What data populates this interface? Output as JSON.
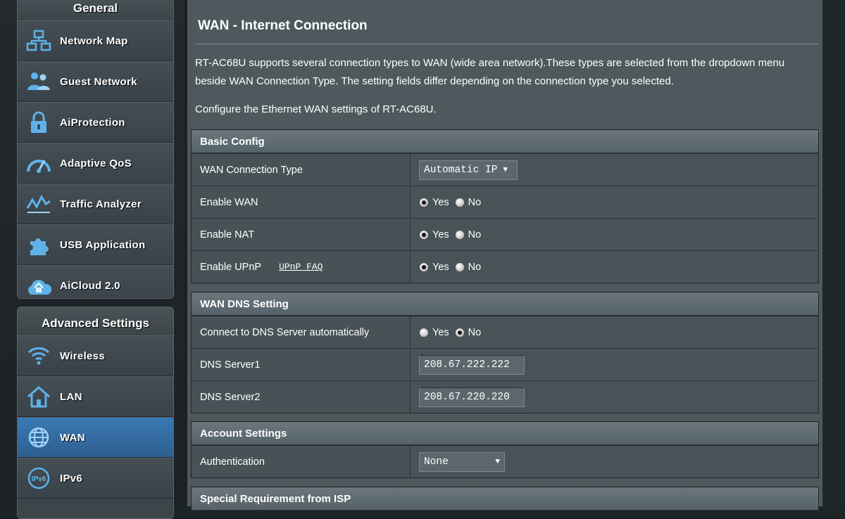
{
  "sidebar": {
    "general_heading": "General",
    "general_items": [
      {
        "label": "Network Map",
        "icon": "network-map-icon"
      },
      {
        "label": "Guest Network",
        "icon": "guest-network-icon"
      },
      {
        "label": "AiProtection",
        "icon": "lock-icon"
      },
      {
        "label": "Adaptive QoS",
        "icon": "speedometer-icon"
      },
      {
        "label": "Traffic Analyzer",
        "icon": "traffic-chart-icon"
      },
      {
        "label": "USB Application",
        "icon": "puzzle-icon"
      },
      {
        "label": "AiCloud 2.0",
        "icon": "cloud-home-icon"
      }
    ],
    "advanced_heading": "Advanced Settings",
    "advanced_items": [
      {
        "label": "Wireless",
        "icon": "wifi-icon"
      },
      {
        "label": "LAN",
        "icon": "home-icon"
      },
      {
        "label": "WAN",
        "icon": "globe-icon",
        "active": true
      },
      {
        "label": "IPv6",
        "icon": "ipv6-icon"
      }
    ],
    "active_color": "#3b79b3"
  },
  "main": {
    "title": "WAN - Internet Connection",
    "description": "RT-AC68U supports several connection types to WAN (wide area network).These types are selected from the dropdown menu beside WAN Connection Type. The setting fields differ depending on the connection type you selected.",
    "configure_text": "Configure the Ethernet WAN settings of RT-AC68U.",
    "basic_config": {
      "heading": "Basic Config",
      "wan_connection_type": {
        "label": "WAN Connection Type",
        "value": "Automatic IP"
      },
      "enable_wan": {
        "label": "Enable WAN",
        "yes": "Yes",
        "no": "No",
        "selected": "yes"
      },
      "enable_nat": {
        "label": "Enable NAT",
        "yes": "Yes",
        "no": "No",
        "selected": "yes"
      },
      "enable_upnp": {
        "label": "Enable UPnP",
        "link": "UPnP FAQ",
        "yes": "Yes",
        "no": "No",
        "selected": "yes"
      }
    },
    "dns": {
      "heading": "WAN DNS Setting",
      "auto": {
        "label": "Connect to DNS Server automatically",
        "yes": "Yes",
        "no": "No",
        "selected": "no"
      },
      "server1": {
        "label": "DNS Server1",
        "value": "208.67.222.222"
      },
      "server2": {
        "label": "DNS Server2",
        "value": "208.67.220.220"
      }
    },
    "account": {
      "heading": "Account Settings",
      "authentication": {
        "label": "Authentication",
        "value": "None"
      }
    },
    "special": {
      "heading": "Special Requirement from ISP"
    }
  }
}
